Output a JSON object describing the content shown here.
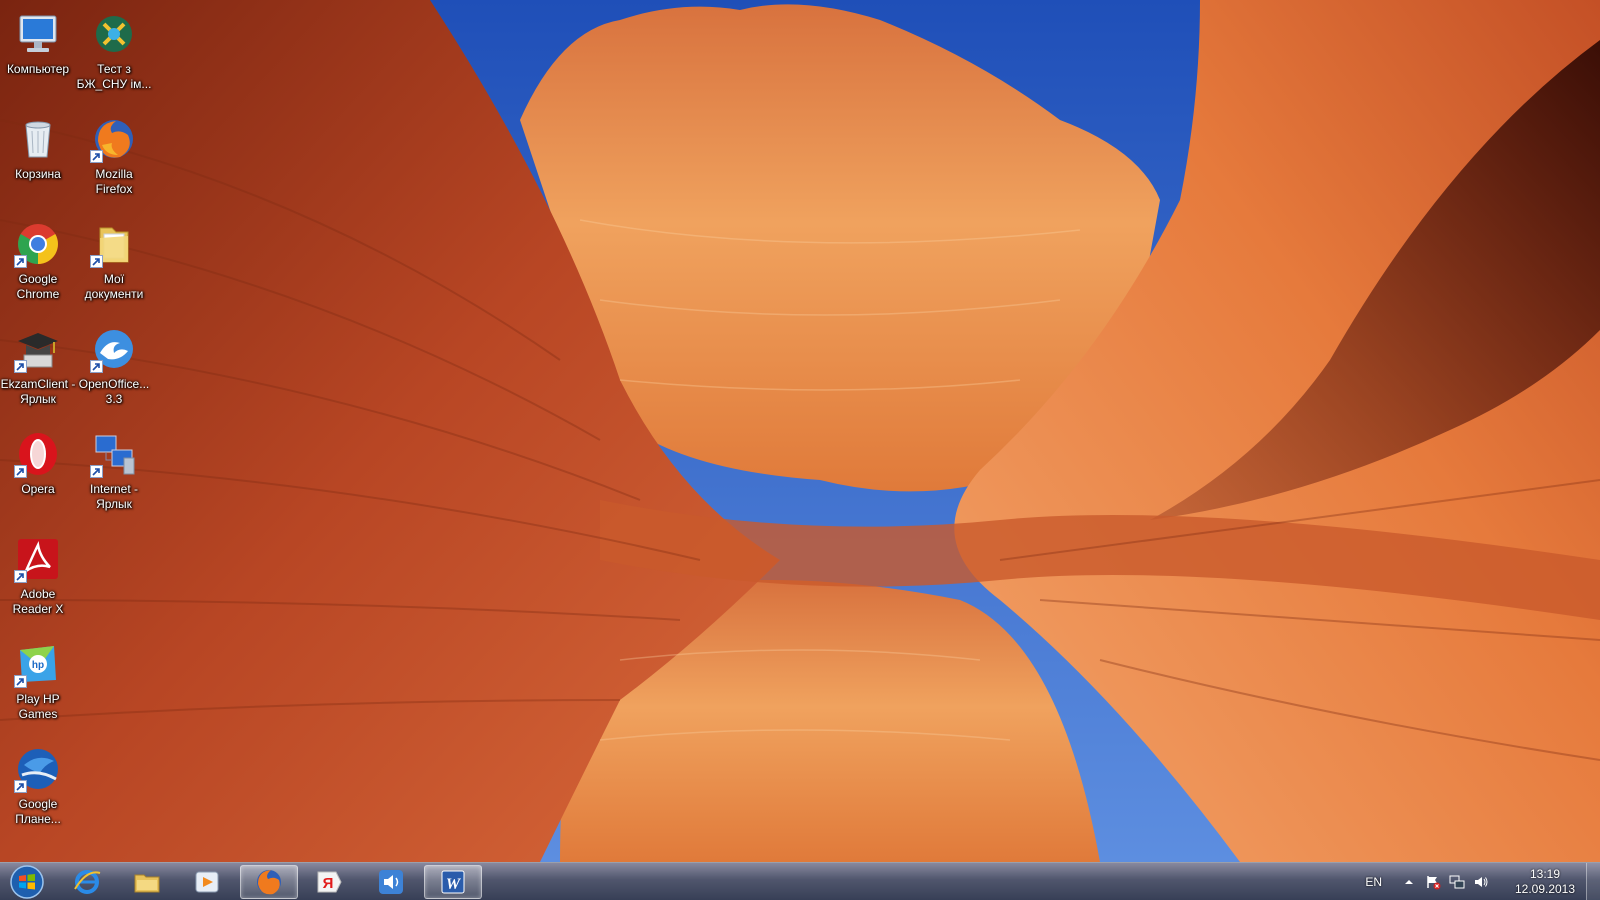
{
  "desktop": {
    "icons": [
      {
        "label": "Компьютер",
        "icon": "computer-icon",
        "shortcut": false
      },
      {
        "label": "Тест з БЖ_СНУ ім...",
        "icon": "test-app-icon",
        "shortcut": false
      },
      {
        "label": "Корзина",
        "icon": "recycle-bin-icon",
        "shortcut": false
      },
      {
        "label": "Mozilla Firefox",
        "icon": "firefox-icon",
        "shortcut": true
      },
      {
        "label": "Google Chrome",
        "icon": "chrome-icon",
        "shortcut": true
      },
      {
        "label": "Мої документи",
        "icon": "folder-icon",
        "shortcut": true
      },
      {
        "label": "EkzamClient - Ярлык",
        "icon": "graduation-cap-icon",
        "shortcut": true
      },
      {
        "label": "OpenOffice... 3.3",
        "icon": "openoffice-icon",
        "shortcut": true
      },
      {
        "label": "Opera",
        "icon": "opera-icon",
        "shortcut": true
      },
      {
        "label": "Internet - Ярлык",
        "icon": "network-computers-icon",
        "shortcut": true
      },
      {
        "label": "Adobe Reader X",
        "icon": "adobe-reader-icon",
        "shortcut": true
      },
      {
        "label": "Play HP Games",
        "icon": "hp-games-icon",
        "shortcut": true
      },
      {
        "label": "Google Плане...",
        "icon": "google-earth-icon",
        "shortcut": true
      }
    ]
  },
  "taskbar": {
    "start_icon": "windows-start-icon",
    "pinned": [
      {
        "icon": "internet-explorer-icon",
        "active": false
      },
      {
        "icon": "file-explorer-icon",
        "active": false
      },
      {
        "icon": "media-player-icon",
        "active": false
      },
      {
        "icon": "firefox-icon",
        "active": true
      },
      {
        "icon": "yandex-icon",
        "active": false
      },
      {
        "icon": "speaker-app-icon",
        "active": false
      },
      {
        "icon": "word-icon",
        "active": true
      }
    ],
    "tray": {
      "language": "EN",
      "time": "13:19",
      "date": "12.09.2013",
      "icons": [
        "show-hidden-icons-chevron-icon",
        "action-center-flag-icon",
        "network-icon",
        "volume-icon"
      ]
    }
  },
  "colors": {
    "sky": "#2f62c9",
    "rock_dark": "#8a2a14",
    "rock_mid": "#d1602a",
    "rock_light": "#f2a15a"
  }
}
